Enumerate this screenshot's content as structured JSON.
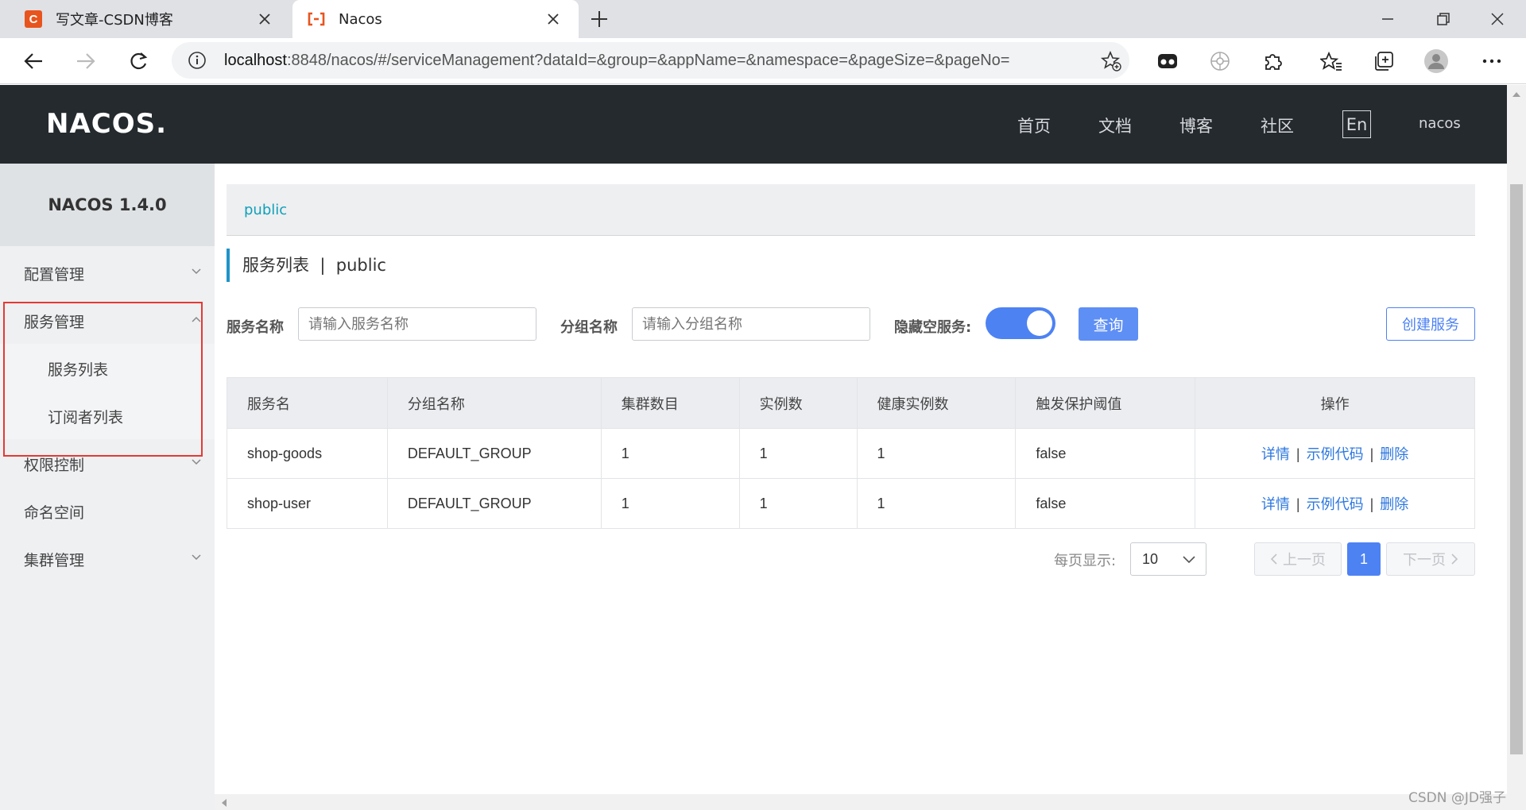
{
  "browser": {
    "tabs": [
      {
        "title": "写文章-CSDN博客",
        "favicon": "csdn-logo-icon",
        "favicon_letter": "C",
        "active": false
      },
      {
        "title": "Nacos",
        "favicon": "nacos-logo-icon",
        "active": true
      }
    ],
    "url": {
      "host": "localhost",
      "rest": ":8848/nacos/#/serviceManagement?dataId=&group=&appName=&namespace=&pageSize=&pageNo="
    },
    "accent": "#e8541e"
  },
  "header": {
    "logo": "NACOS.",
    "nav": [
      "首页",
      "文档",
      "博客",
      "社区"
    ],
    "lang": "En",
    "user": "nacos",
    "background": "#252a2f"
  },
  "sidebar": {
    "version": "NACOS 1.4.0",
    "items": [
      {
        "label": "配置管理",
        "expanded": false
      },
      {
        "label": "服务管理",
        "expanded": true,
        "children": [
          "服务列表",
          "订阅者列表"
        ]
      },
      {
        "label": "权限控制",
        "expanded": false
      },
      {
        "label": "命名空间"
      },
      {
        "label": "集群管理",
        "expanded": false
      }
    ]
  },
  "namespace": {
    "current": "public"
  },
  "page": {
    "title": "服务列表",
    "separator": "|",
    "namespace": "public"
  },
  "filters": {
    "service_name_label": "服务名称",
    "service_name_placeholder": "请输入服务名称",
    "group_name_label": "分组名称",
    "group_name_placeholder": "请输入分组名称",
    "hide_empty_label": "隐藏空服务:",
    "hide_empty_on": true,
    "query_label": "查询",
    "create_label": "创建服务"
  },
  "table": {
    "columns": [
      "服务名",
      "分组名称",
      "集群数目",
      "实例数",
      "健康实例数",
      "触发保护阈值",
      "操作"
    ],
    "rows": [
      {
        "name": "shop-goods",
        "group": "DEFAULT_GROUP",
        "clusters": "1",
        "instances": "1",
        "healthy": "1",
        "threshold": "false"
      },
      {
        "name": "shop-user",
        "group": "DEFAULT_GROUP",
        "clusters": "1",
        "instances": "1",
        "healthy": "1",
        "threshold": "false"
      }
    ],
    "actions": [
      "详情",
      "示例代码",
      "删除"
    ]
  },
  "pagination": {
    "per_page_label": "每页显示:",
    "page_size": "10",
    "prev_label": "上一页",
    "next_label": "下一页",
    "current_page": "1"
  },
  "watermark": "CSDN @JD强子"
}
